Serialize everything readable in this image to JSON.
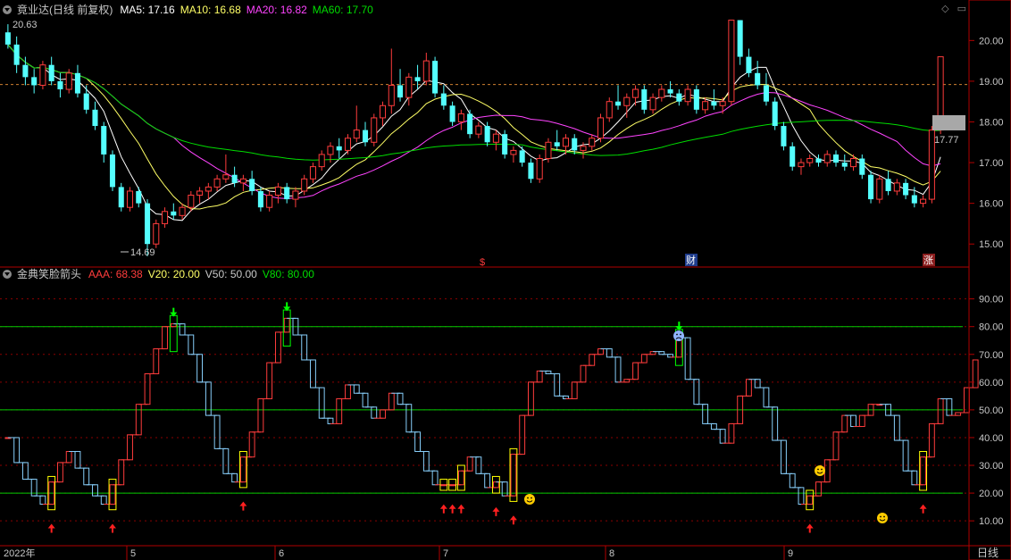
{
  "stock_header": {
    "name": "竟业达(日线 前复权)",
    "ma5": "MA5: 17.16",
    "ma10": "MA10: 16.68",
    "ma20": "MA20: 16.82",
    "ma60": "MA60: 17.70"
  },
  "indicator_header": {
    "name": "金典笑脸箭头",
    "aaa": "AAA: 68.38",
    "v20": "V20: 20.00",
    "v50": "V50: 50.00",
    "v80": "V80: 80.00"
  },
  "price_axis_labels": [
    "20.00",
    "19.00",
    "18.00",
    "17.00",
    "16.00",
    "15.00"
  ],
  "indicator_axis_labels": [
    "90.00",
    "80.00",
    "70.00",
    "60.00",
    "50.00",
    "40.00",
    "30.00",
    "20.00",
    "10.00"
  ],
  "date_labels": [
    "2022年",
    "5",
    "6",
    "7",
    "8",
    "9"
  ],
  "period_button": "日线",
  "annotations": {
    "high_label": "20.63",
    "low_label": "14.69",
    "last_price": "17.77",
    "event_s": "$",
    "event_cai": "财",
    "event_zhang": "涨"
  },
  "colors": {
    "up": "#ff3c3c",
    "down": "#54ffff",
    "ma5": "#ffffff",
    "ma10": "#ffff66",
    "ma20": "#ff44ff",
    "ma60": "#00dd00",
    "kdj_up": "#ff3c3c",
    "kdj_down": "#87cefa",
    "signal_box": "#ffff00",
    "ref_line": "#00cc00",
    "grid": "#8b0000"
  },
  "chart_data": [
    {
      "type": "candlestick",
      "title": "竟业达(日线 前复权)",
      "ylim": [
        14.5,
        20.6
      ],
      "y_ticks": [
        15,
        16,
        17,
        18,
        19,
        20
      ],
      "candles": [
        [
          20.2,
          20.4,
          19.8,
          19.9
        ],
        [
          19.9,
          20.1,
          19.2,
          19.4
        ],
        [
          19.4,
          19.6,
          18.9,
          19.1
        ],
        [
          19.1,
          19.3,
          18.7,
          18.9
        ],
        [
          18.9,
          19.5,
          18.8,
          19.4
        ],
        [
          19.4,
          19.6,
          18.9,
          19.0
        ],
        [
          19.0,
          19.2,
          18.6,
          18.8
        ],
        [
          18.8,
          19.3,
          18.7,
          19.2
        ],
        [
          19.2,
          19.4,
          18.6,
          18.7
        ],
        [
          18.7,
          18.9,
          18.2,
          18.3
        ],
        [
          18.3,
          18.5,
          17.8,
          17.9
        ],
        [
          17.9,
          18.0,
          17.0,
          17.2
        ],
        [
          17.2,
          17.3,
          16.3,
          16.4
        ],
        [
          16.4,
          16.5,
          15.8,
          15.9
        ],
        [
          15.9,
          16.4,
          15.8,
          16.3
        ],
        [
          16.3,
          16.4,
          15.9,
          16.0
        ],
        [
          16.0,
          16.1,
          14.7,
          15.0
        ],
        [
          15.0,
          15.6,
          14.9,
          15.5
        ],
        [
          15.5,
          15.9,
          15.4,
          15.8
        ],
        [
          15.8,
          16.0,
          15.6,
          15.7
        ],
        [
          15.7,
          16.0,
          15.6,
          15.9
        ],
        [
          15.9,
          16.3,
          15.8,
          16.2
        ],
        [
          16.2,
          16.4,
          16.0,
          16.3
        ],
        [
          16.3,
          16.5,
          16.1,
          16.4
        ],
        [
          16.4,
          16.7,
          16.3,
          16.6
        ],
        [
          16.6,
          17.2,
          16.5,
          16.7
        ],
        [
          16.7,
          16.9,
          16.4,
          16.5
        ],
        [
          16.5,
          16.7,
          16.3,
          16.6
        ],
        [
          16.6,
          16.8,
          16.2,
          16.3
        ],
        [
          16.3,
          16.4,
          15.8,
          15.9
        ],
        [
          15.9,
          16.3,
          15.8,
          16.2
        ],
        [
          16.2,
          16.5,
          16.0,
          16.4
        ],
        [
          16.4,
          16.5,
          16.0,
          16.1
        ],
        [
          16.1,
          16.4,
          15.9,
          16.3
        ],
        [
          16.3,
          16.7,
          16.2,
          16.6
        ],
        [
          16.6,
          17.0,
          16.5,
          16.9
        ],
        [
          16.9,
          17.3,
          16.8,
          17.2
        ],
        [
          17.2,
          17.5,
          17.0,
          17.4
        ],
        [
          17.4,
          17.6,
          17.1,
          17.3
        ],
        [
          17.3,
          17.7,
          17.2,
          17.6
        ],
        [
          17.6,
          18.4,
          17.5,
          17.8
        ],
        [
          17.8,
          18.0,
          17.4,
          17.5
        ],
        [
          17.5,
          18.2,
          17.4,
          18.1
        ],
        [
          18.1,
          18.5,
          17.9,
          18.4
        ],
        [
          18.4,
          19.8,
          18.2,
          18.9
        ],
        [
          18.9,
          19.3,
          18.5,
          18.6
        ],
        [
          18.6,
          19.2,
          18.4,
          19.1
        ],
        [
          19.1,
          19.4,
          18.8,
          19.0
        ],
        [
          19.0,
          19.7,
          18.9,
          19.5
        ],
        [
          19.5,
          19.6,
          18.6,
          18.7
        ],
        [
          18.7,
          18.9,
          18.3,
          18.4
        ],
        [
          18.4,
          18.5,
          17.9,
          18.0
        ],
        [
          18.0,
          18.3,
          17.8,
          18.2
        ],
        [
          18.2,
          18.3,
          17.6,
          17.7
        ],
        [
          17.7,
          18.0,
          17.6,
          17.9
        ],
        [
          17.9,
          18.0,
          17.4,
          17.5
        ],
        [
          17.5,
          17.8,
          17.3,
          17.7
        ],
        [
          17.7,
          17.8,
          17.1,
          17.2
        ],
        [
          17.2,
          17.4,
          17.0,
          17.3
        ],
        [
          17.3,
          17.4,
          16.9,
          17.0
        ],
        [
          17.0,
          17.1,
          16.5,
          16.6
        ],
        [
          16.6,
          17.2,
          16.5,
          17.1
        ],
        [
          17.1,
          17.6,
          17.0,
          17.5
        ],
        [
          17.5,
          17.8,
          17.3,
          17.4
        ],
        [
          17.4,
          17.7,
          17.2,
          17.6
        ],
        [
          17.6,
          17.7,
          17.2,
          17.3
        ],
        [
          17.3,
          17.5,
          17.1,
          17.4
        ],
        [
          17.4,
          17.7,
          17.3,
          17.6
        ],
        [
          17.6,
          18.2,
          17.5,
          18.1
        ],
        [
          18.1,
          18.6,
          18.0,
          18.5
        ],
        [
          18.5,
          18.9,
          18.3,
          18.4
        ],
        [
          18.4,
          18.7,
          18.1,
          18.6
        ],
        [
          18.6,
          18.9,
          18.4,
          18.8
        ],
        [
          18.8,
          18.9,
          18.2,
          18.3
        ],
        [
          18.3,
          18.7,
          18.2,
          18.6
        ],
        [
          18.6,
          18.9,
          18.5,
          18.8
        ],
        [
          18.8,
          19.0,
          18.6,
          18.7
        ],
        [
          18.7,
          18.8,
          18.4,
          18.5
        ],
        [
          18.5,
          18.9,
          18.4,
          18.8
        ],
        [
          18.8,
          18.9,
          18.2,
          18.3
        ],
        [
          18.3,
          18.6,
          18.2,
          18.5
        ],
        [
          18.5,
          18.8,
          18.3,
          18.4
        ],
        [
          18.4,
          18.6,
          18.2,
          18.5
        ],
        [
          18.5,
          20.5,
          18.4,
          20.5
        ],
        [
          20.5,
          20.5,
          19.4,
          19.6
        ],
        [
          19.6,
          19.8,
          19.1,
          19.2
        ],
        [
          19.2,
          19.5,
          18.8,
          18.9
        ],
        [
          18.9,
          19.2,
          18.4,
          18.5
        ],
        [
          18.5,
          18.6,
          17.8,
          17.9
        ],
        [
          17.9,
          18.0,
          17.3,
          17.4
        ],
        [
          17.4,
          17.5,
          16.8,
          16.9
        ],
        [
          16.9,
          17.1,
          16.7,
          17.0
        ],
        [
          17.0,
          17.2,
          16.9,
          17.1
        ],
        [
          17.1,
          17.2,
          16.9,
          17.0
        ],
        [
          17.0,
          17.3,
          16.9,
          17.2
        ],
        [
          17.2,
          17.3,
          16.9,
          17.0
        ],
        [
          17.0,
          17.2,
          16.8,
          16.9
        ],
        [
          16.9,
          17.2,
          16.8,
          17.1
        ],
        [
          17.1,
          17.2,
          16.6,
          16.7
        ],
        [
          16.7,
          16.8,
          16.0,
          16.1
        ],
        [
          16.1,
          16.7,
          16.0,
          16.6
        ],
        [
          16.6,
          16.8,
          16.2,
          16.3
        ],
        [
          16.3,
          16.6,
          16.2,
          16.5
        ],
        [
          16.5,
          16.6,
          16.1,
          16.2
        ],
        [
          16.2,
          16.4,
          15.9,
          16.0
        ],
        [
          16.0,
          16.2,
          15.9,
          16.1
        ],
        [
          16.1,
          17.9,
          16.0,
          17.8
        ],
        [
          17.8,
          19.6,
          17.7,
          19.6
        ]
      ]
    },
    {
      "type": "line",
      "title": "金典笑脸箭头",
      "ylim": [
        2,
        96
      ],
      "y_ticks": [
        10,
        20,
        30,
        40,
        50,
        60,
        70,
        80,
        90
      ],
      "reference_lines": [
        20,
        50,
        80
      ],
      "values": [
        40,
        31,
        25,
        19,
        16,
        24,
        31,
        35,
        29,
        23,
        19,
        16,
        23,
        32,
        41,
        52,
        63,
        72,
        80,
        81,
        77,
        70,
        60,
        48,
        36,
        27,
        24,
        33,
        42,
        54,
        67,
        78,
        83,
        77,
        68,
        58,
        47,
        45,
        54,
        59,
        56,
        51,
        47,
        50,
        56,
        52,
        42,
        35,
        28,
        23,
        23,
        23,
        28,
        33,
        27,
        22,
        24,
        19,
        34,
        48,
        60,
        64,
        63,
        55,
        54,
        60,
        66,
        70,
        72,
        69,
        60,
        61,
        67,
        70,
        71,
        70,
        69,
        76,
        61,
        52,
        45,
        43,
        38,
        45,
        55,
        61,
        58,
        51,
        39,
        27,
        22,
        16,
        19,
        24,
        32,
        42,
        48,
        44,
        48,
        52,
        52,
        48,
        39,
        28,
        23,
        33,
        45,
        54,
        48,
        49,
        58,
        68
      ]
    }
  ]
}
